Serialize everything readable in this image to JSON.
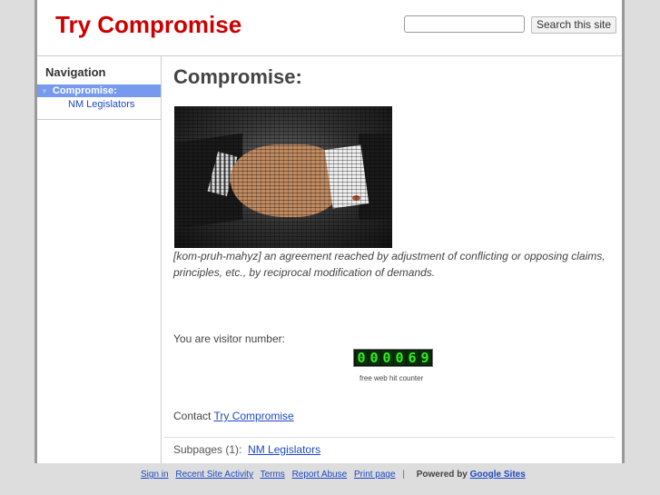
{
  "header": {
    "site_title": "Try Compromise",
    "search_placeholder": "",
    "search_value": "",
    "search_button_label": "Search this site"
  },
  "sidebar": {
    "heading": "Navigation",
    "items": [
      {
        "label": "Compromise:",
        "active": true,
        "expand_icon": "triangle-down-icon"
      },
      {
        "label": "NM Legislators",
        "active": false
      }
    ]
  },
  "main": {
    "page_title": "Compromise:",
    "image_alt": "handshake",
    "definition": " [kom-pruh-mahyz] an agreement reached by adjustment of conflicting or opposing claims, principles, etc., by reciprocal modification of demands.",
    "visitor_label": "You are visitor number:",
    "counter_digits": [
      "0",
      "0",
      "0",
      "0",
      "6",
      "9"
    ],
    "counter_value": "000069",
    "counter_caption": "free web hit counter",
    "contact_prefix": "Contact",
    "contact_link": "Try Compromise",
    "subpages_label": "Subpages (1):",
    "subpages": [
      {
        "label": "NM Legislators"
      }
    ]
  },
  "footer": {
    "links": [
      {
        "label": "Sign in"
      },
      {
        "label": "Recent Site Activity"
      },
      {
        "label": "Terms"
      },
      {
        "label": "Report Abuse"
      },
      {
        "label": "Print page"
      }
    ],
    "separator": "|",
    "powered_by_prefix": "Powered by",
    "powered_by_link": "Google Sites"
  },
  "colors": {
    "title_red": "#cc0000",
    "link_blue": "#1d48c4",
    "nav_active_bg": "#7799ee",
    "counter_green": "#33ee22"
  }
}
